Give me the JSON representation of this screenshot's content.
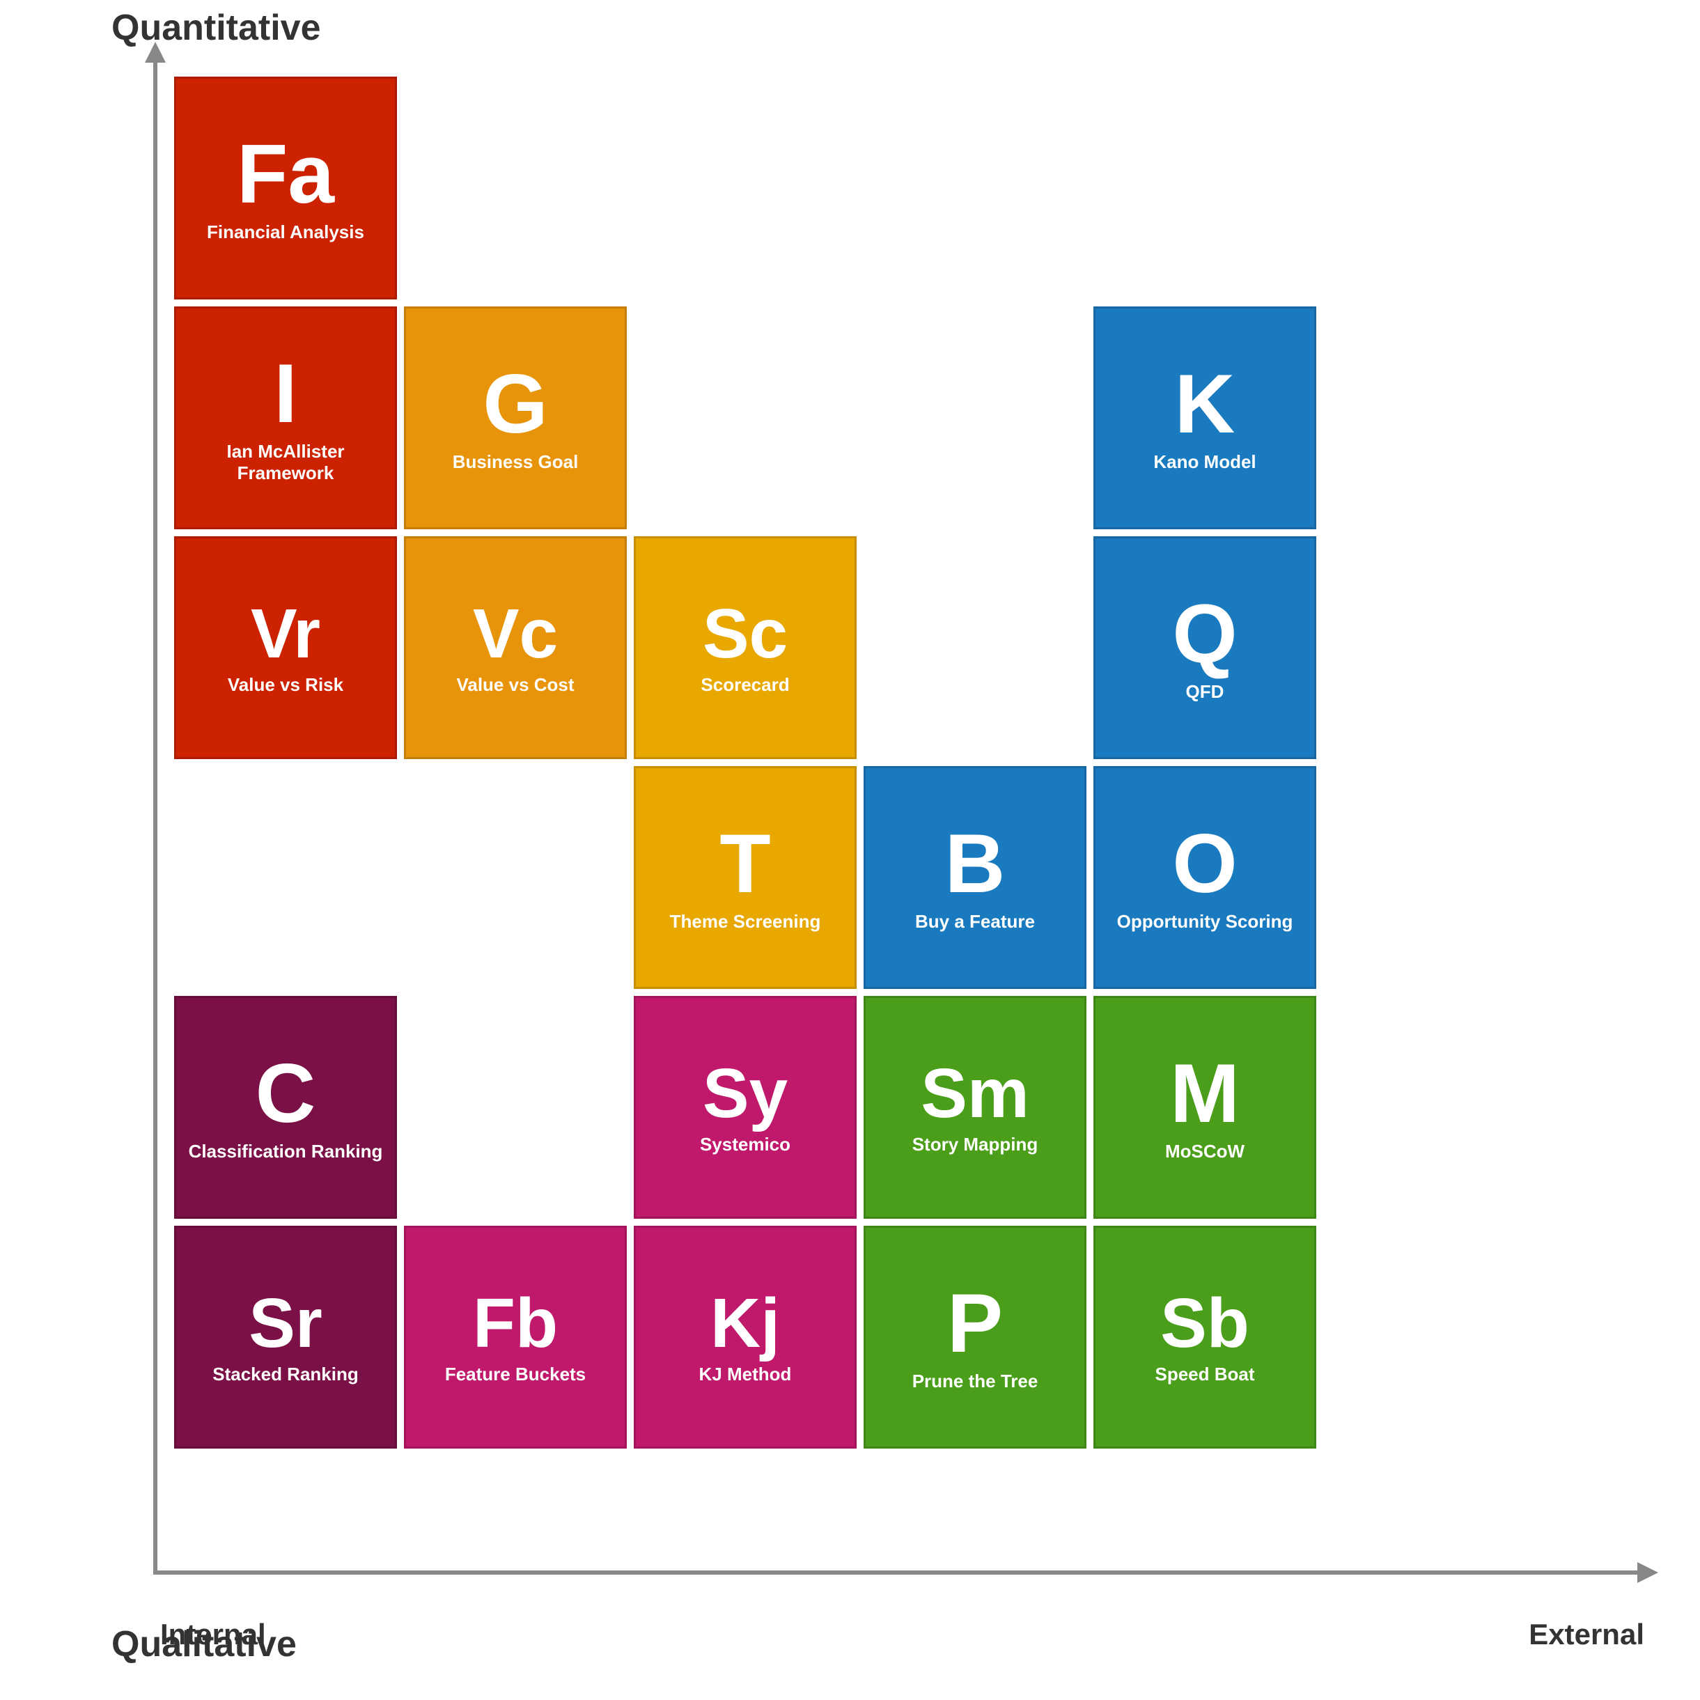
{
  "axes": {
    "quantitative": "Quantitative",
    "qualitative": "Qualitative",
    "internal": "Internal",
    "external": "External"
  },
  "cards": [
    {
      "id": "fa",
      "abbr": "Fa",
      "name": "Financial Analysis",
      "color": "red",
      "col": 1,
      "row": 1,
      "abbr_size": "large"
    },
    {
      "id": "i",
      "abbr": "I",
      "name": "Ian McAllister Framework",
      "color": "red",
      "col": 1,
      "row": 2,
      "abbr_size": "large"
    },
    {
      "id": "g",
      "abbr": "G",
      "name": "Business Goal",
      "color": "orange",
      "col": 2,
      "row": 2,
      "abbr_size": "large"
    },
    {
      "id": "vr",
      "abbr": "Vr",
      "name": "Value vs Risk",
      "color": "red",
      "col": 1,
      "row": 3,
      "abbr_size": "normal"
    },
    {
      "id": "vc",
      "abbr": "Vc",
      "name": "Value vs Cost",
      "color": "orange",
      "col": 2,
      "row": 3,
      "abbr_size": "normal"
    },
    {
      "id": "sc",
      "abbr": "Sc",
      "name": "Scorecard",
      "color": "yellow",
      "col": 3,
      "row": 3,
      "abbr_size": "normal"
    },
    {
      "id": "k",
      "abbr": "K",
      "name": "Kano Model",
      "color": "blue",
      "col": 5,
      "row": 2,
      "abbr_size": "large"
    },
    {
      "id": "q",
      "abbr": "Q",
      "name": "QFD",
      "color": "blue",
      "col": 5,
      "row": 3,
      "abbr_size": "large"
    },
    {
      "id": "t",
      "abbr": "T",
      "name": "Theme Screening",
      "color": "yellow",
      "col": 3,
      "row": 4,
      "abbr_size": "large"
    },
    {
      "id": "b",
      "abbr": "B",
      "name": "Buy a Feature",
      "color": "blue",
      "col": 4,
      "row": 4,
      "abbr_size": "large"
    },
    {
      "id": "o",
      "abbr": "O",
      "name": "Opportunity Scoring",
      "color": "blue",
      "col": 5,
      "row": 4,
      "abbr_size": "large"
    },
    {
      "id": "c",
      "abbr": "C",
      "name": "Classification Ranking",
      "color": "purple",
      "col": 1,
      "row": 5,
      "abbr_size": "large"
    },
    {
      "id": "sy",
      "abbr": "Sy",
      "name": "Systemico",
      "color": "magenta",
      "col": 3,
      "row": 5,
      "abbr_size": "normal"
    },
    {
      "id": "sm",
      "abbr": "Sm",
      "name": "Story Mapping",
      "color": "green",
      "col": 4,
      "row": 5,
      "abbr_size": "normal"
    },
    {
      "id": "m",
      "abbr": "M",
      "name": "MoSCoW",
      "color": "green",
      "col": 5,
      "row": 5,
      "abbr_size": "large"
    },
    {
      "id": "sr",
      "abbr": "Sr",
      "name": "Stacked Ranking",
      "color": "purple",
      "col": 1,
      "row": 6,
      "abbr_size": "normal"
    },
    {
      "id": "fb",
      "abbr": "Fb",
      "name": "Feature Buckets",
      "color": "magenta",
      "col": 2,
      "row": 6,
      "abbr_size": "normal"
    },
    {
      "id": "kj",
      "abbr": "Kj",
      "name": "KJ Method",
      "color": "magenta",
      "col": 3,
      "row": 6,
      "abbr_size": "normal"
    },
    {
      "id": "p",
      "abbr": "P",
      "name": "Prune the Tree",
      "color": "green",
      "col": 4,
      "row": 6,
      "abbr_size": "large"
    },
    {
      "id": "sb",
      "abbr": "Sb",
      "name": "Speed Boat",
      "color": "green",
      "col": 5,
      "row": 6,
      "abbr_size": "normal"
    }
  ]
}
